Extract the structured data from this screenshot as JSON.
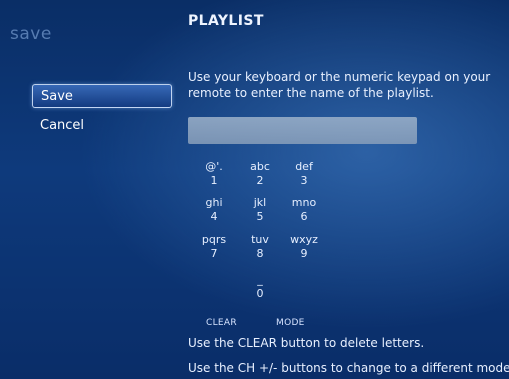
{
  "context_title": "save",
  "page_title": "PLAYLIST",
  "instructions": "Use your keyboard or the numeric keypad on your remote to enter the name of the playlist.",
  "menu": {
    "items": [
      {
        "label": "Save",
        "focused": true
      },
      {
        "label": "Cancel",
        "focused": false
      }
    ]
  },
  "name_input": {
    "value": ""
  },
  "keypad": {
    "keys": [
      {
        "letters": "@'.",
        "digit": "1"
      },
      {
        "letters": "abc",
        "digit": "2"
      },
      {
        "letters": "def",
        "digit": "3"
      },
      {
        "letters": "ghi",
        "digit": "4"
      },
      {
        "letters": "jkl",
        "digit": "5"
      },
      {
        "letters": "mno",
        "digit": "6"
      },
      {
        "letters": "pqrs",
        "digit": "7"
      },
      {
        "letters": "tuv",
        "digit": "8"
      },
      {
        "letters": "wxyz",
        "digit": "9"
      },
      {
        "letters": "_",
        "digit": "0"
      }
    ],
    "clear_label": "CLEAR",
    "mode_label": "MODE"
  },
  "hints": [
    "Use the CLEAR button to delete letters.",
    "Use the CH +/- buttons to change to a different mode"
  ]
}
